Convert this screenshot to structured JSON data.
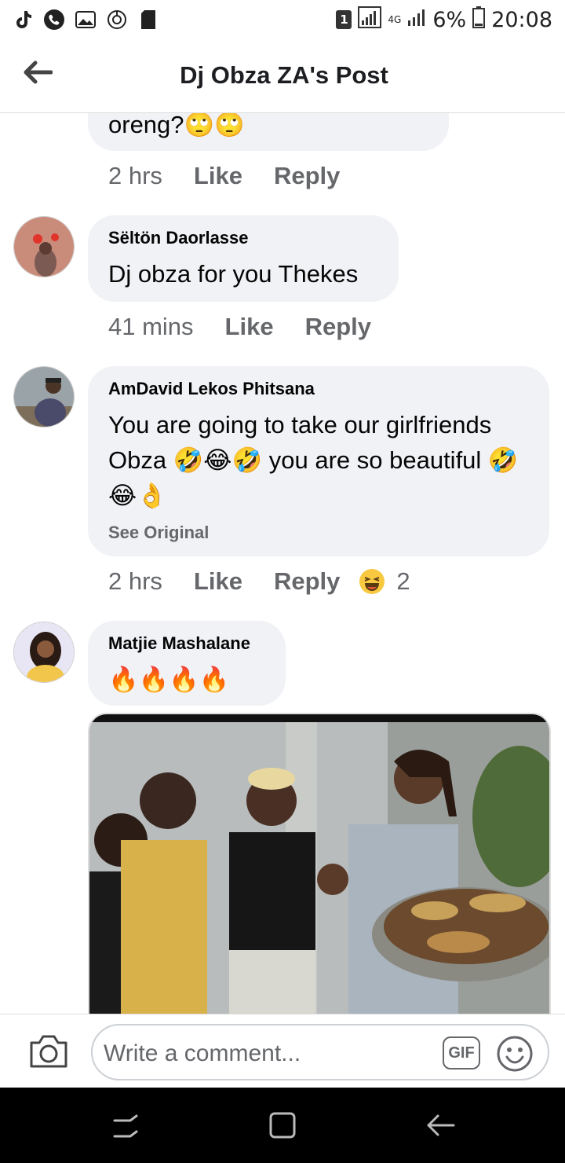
{
  "status_bar": {
    "left_icons": [
      "tiktok-icon",
      "phone-icon",
      "gallery-icon",
      "lens-icon",
      "sd-card-icon"
    ],
    "sim": "1",
    "network": "4G",
    "battery": "6%",
    "time": "20:08"
  },
  "header": {
    "title": "Dj Obza ZA's Post",
    "back_icon": "back-arrow-icon"
  },
  "comments": [
    {
      "text": "oreng?🙄🙄",
      "time": "2 hrs",
      "like_label": "Like",
      "reply_label": "Reply"
    },
    {
      "name": "Sëltön Daorlasse",
      "text": "Dj obza for you Thekes",
      "time": "41 mins",
      "like_label": "Like",
      "reply_label": "Reply"
    },
    {
      "name": "AmDavid Lekos Phitsana",
      "text": "You are going to take our girlfriends Obza 🤣😂🤣 you are so beautiful 🤣😂👌",
      "see_original": "See Original",
      "time": "2 hrs",
      "like_label": "Like",
      "reply_label": "Reply",
      "reaction_count": "2",
      "reaction_icon": "haha-reaction-icon"
    },
    {
      "name": "Matjie Mashalane",
      "text": "🔥🔥🔥🔥"
    }
  ],
  "composer": {
    "placeholder": "Write a comment...",
    "gif_label": "GIF"
  },
  "colors": {
    "bubble": "#f0f2f5",
    "meta_text": "#65676b",
    "header_text": "#1c1e21"
  }
}
